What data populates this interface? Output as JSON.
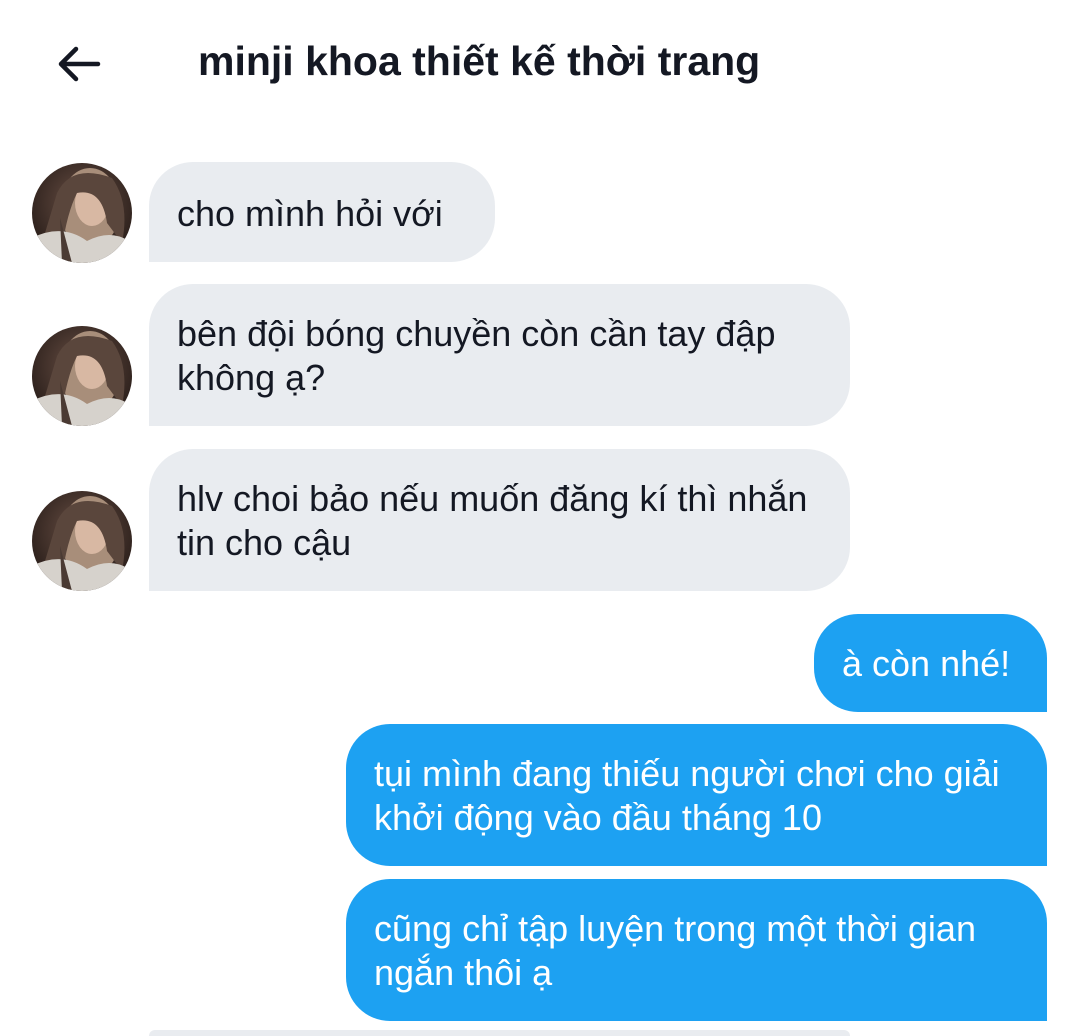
{
  "header": {
    "title": "minji khoa thiết kế thời trang",
    "back_icon": "arrow-left-icon"
  },
  "colors": {
    "incoming_bubble": "#e9ecf0",
    "outgoing_bubble": "#1da1f2",
    "text_dark": "#141823"
  },
  "messages": [
    {
      "from": "them",
      "text": "cho mình hỏi với"
    },
    {
      "from": "them",
      "text": "bên đội bóng chuyền còn cần tay đập không ạ?"
    },
    {
      "from": "them",
      "text": "hlv choi bảo nếu muốn đăng kí thì nhắn tin cho cậu"
    },
    {
      "from": "me",
      "text": "à còn nhé!"
    },
    {
      "from": "me",
      "text": "tụi mình đang thiếu người chơi cho giải khởi động vào đầu tháng 10"
    },
    {
      "from": "me",
      "text": "cũng chỉ tập luyện trong một thời gian ngắn thôi ạ"
    }
  ]
}
